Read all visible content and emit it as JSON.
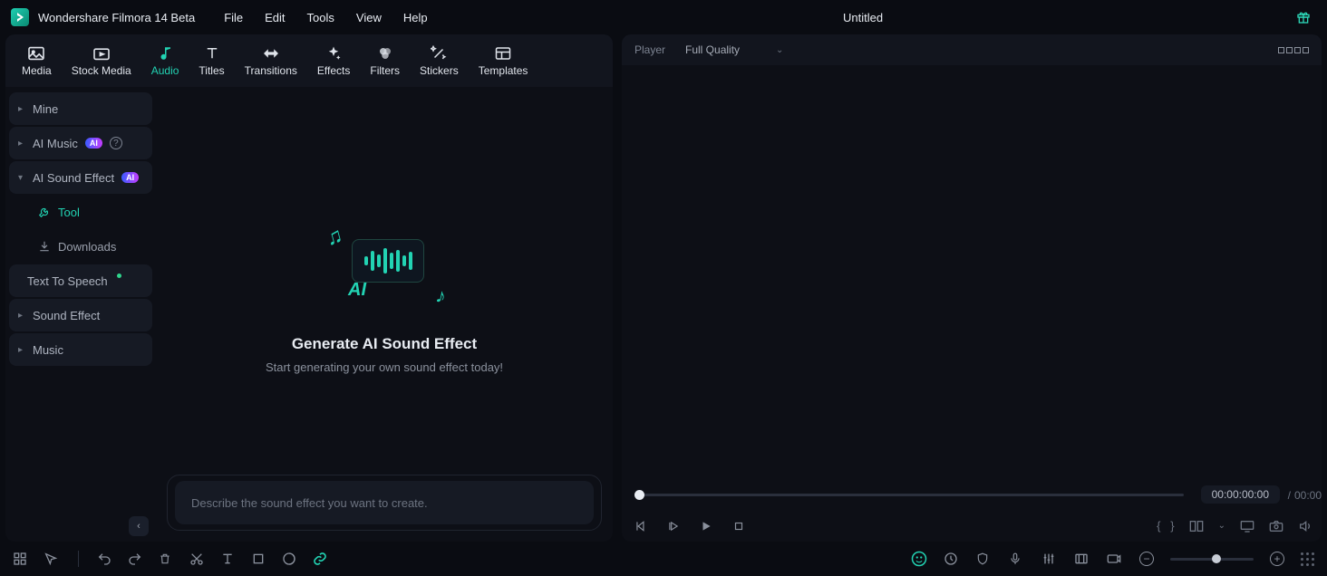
{
  "app": {
    "title": "Wondershare Filmora 14 Beta",
    "doc_title": "Untitled"
  },
  "menu": {
    "file": "File",
    "edit": "Edit",
    "tools": "Tools",
    "view": "View",
    "help": "Help"
  },
  "tabs": {
    "media": "Media",
    "stock": "Stock Media",
    "audio": "Audio",
    "titles": "Titles",
    "transitions": "Transitions",
    "effects": "Effects",
    "filters": "Filters",
    "stickers": "Stickers",
    "templates": "Templates"
  },
  "sidebar": {
    "mine": "Mine",
    "ai_music": "AI Music",
    "ai_sound_effect": "AI Sound Effect",
    "tool": "Tool",
    "downloads": "Downloads",
    "tts": "Text To Speech",
    "sound_effect": "Sound Effect",
    "music": "Music",
    "badge": "AI"
  },
  "promo": {
    "ai_text": "AI",
    "title": "Generate AI Sound Effect",
    "subtitle": "Start generating your own sound effect today!",
    "placeholder": "Describe the sound effect you want to create."
  },
  "player": {
    "label": "Player",
    "quality": "Full Quality",
    "time_current": "00:00:00:00",
    "time_total": "00:00"
  }
}
